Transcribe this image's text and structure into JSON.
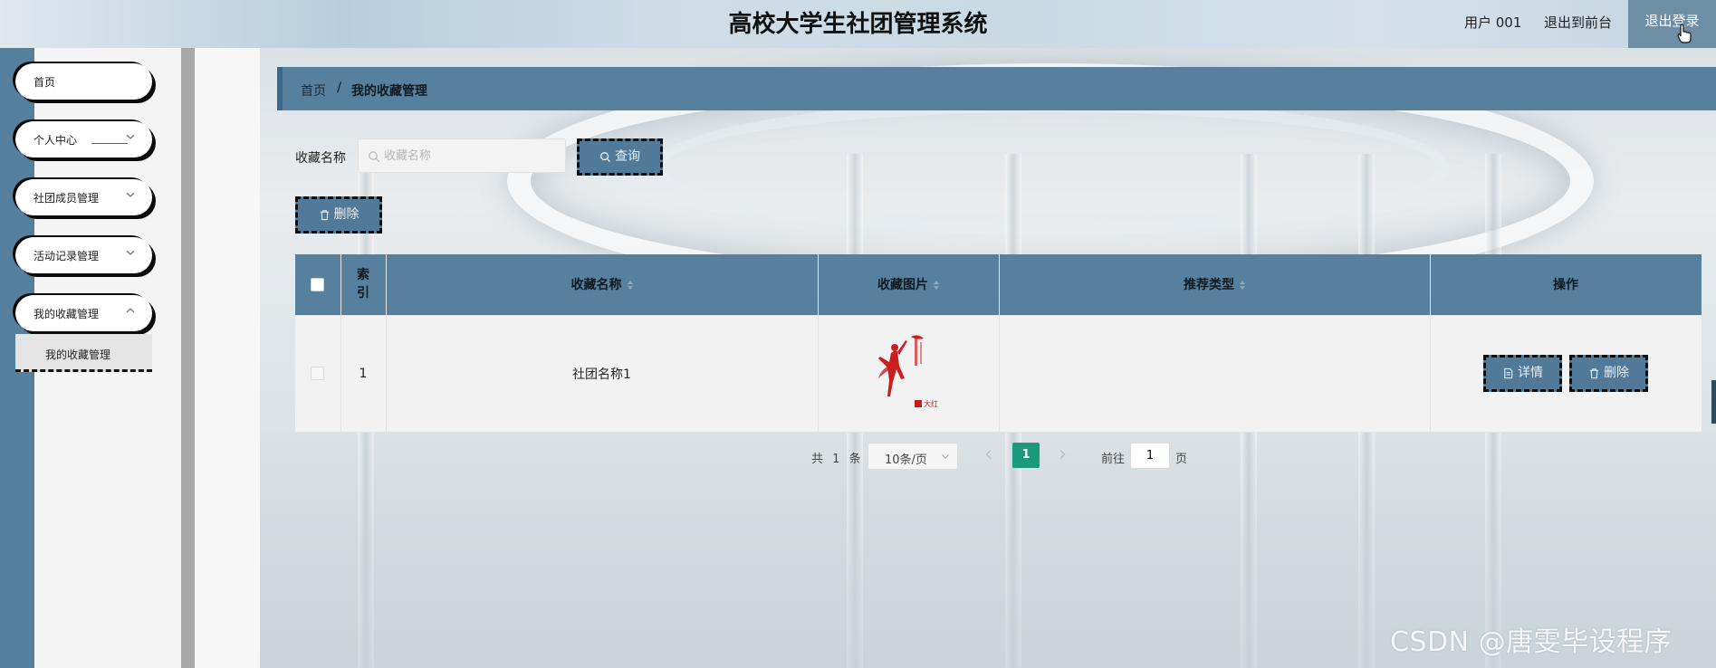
{
  "header": {
    "title": "高校大学生社团管理系统",
    "user_label": "用户 001",
    "to_front_label": "退出到前台",
    "logout_label": "退出登录"
  },
  "sidebar": {
    "items": [
      {
        "label": "首页"
      },
      {
        "label": "个人中心"
      },
      {
        "label": "社团成员管理"
      },
      {
        "label": "活动记录管理"
      },
      {
        "label": "我的收藏管理"
      }
    ],
    "sub_items": [
      {
        "label": "我的收藏管理"
      }
    ]
  },
  "breadcrumb": {
    "home": "首页",
    "separator": "/",
    "current": "我的收藏管理"
  },
  "search": {
    "label": "收藏名称",
    "placeholder": "收藏名称",
    "value": "",
    "query_button": "查询"
  },
  "toolbar": {
    "delete_button": "删除"
  },
  "table": {
    "columns": [
      "索引",
      "收藏名称",
      "收藏图片",
      "推荐类型",
      "操作"
    ],
    "rows": [
      {
        "index": "1",
        "name": "社团名称1",
        "image_caption": "大红",
        "recommend_type": "",
        "detail_button": "详情",
        "delete_button": "删除"
      }
    ]
  },
  "pagination": {
    "total_prefix": "共",
    "total": "1",
    "total_suffix": "条",
    "page_size": "10条/页",
    "current_page": "1",
    "goto_label": "前往",
    "goto_value": "1",
    "page_suffix": "页"
  },
  "watermark": "CSDN @唐雯毕设程序",
  "colors": {
    "accent": "#56809e",
    "pager_active": "#1a9a7a",
    "logout_bg": "#6e8ea5"
  }
}
